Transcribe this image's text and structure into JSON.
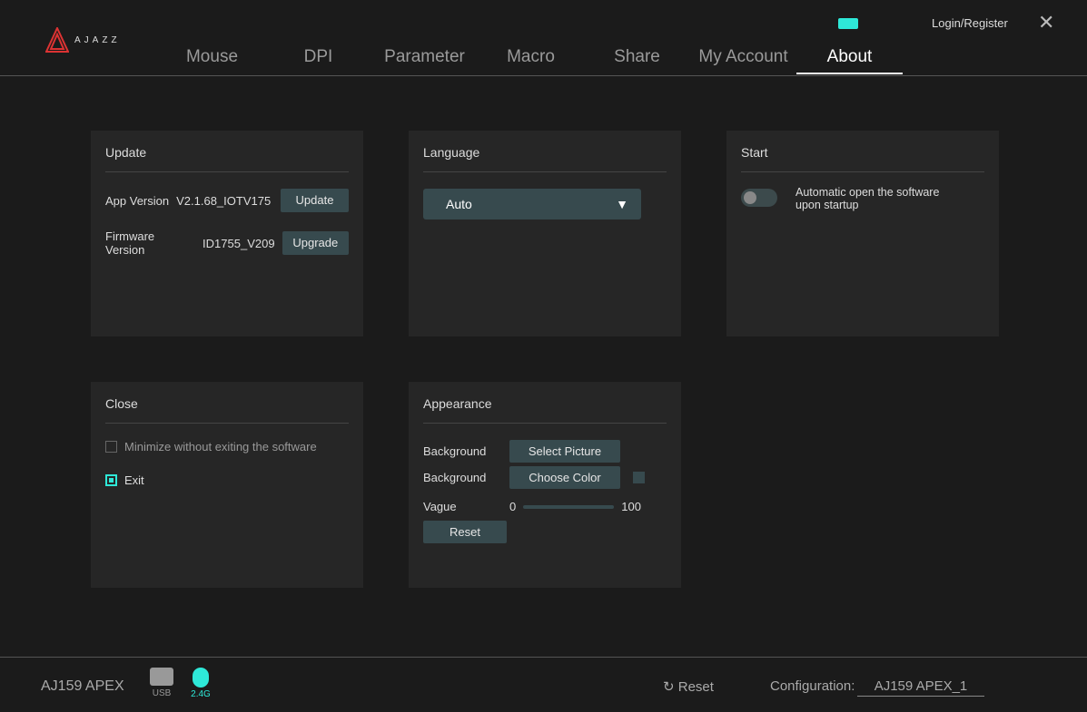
{
  "header": {
    "logo": "AJAZZ",
    "login": "Login/Register",
    "tabs": [
      "Mouse",
      "DPI",
      "Parameter",
      "Macro",
      "Share",
      "My Account",
      "About"
    ],
    "active_tab": "About"
  },
  "update": {
    "title": "Update",
    "app_version_label": "App Version",
    "app_version": "V2.1.68_IOTV175",
    "update_btn": "Update",
    "firmware_label": "Firmware Version",
    "firmware": "ID1755_V209",
    "upgrade_btn": "Upgrade"
  },
  "language": {
    "title": "Language",
    "selected": "Auto"
  },
  "start": {
    "title": "Start",
    "toggle_label": "Automatic open the software upon startup",
    "enabled": false
  },
  "close": {
    "title": "Close",
    "opt1": "Minimize without exiting the software",
    "opt2": "Exit",
    "selected": "Exit"
  },
  "appearance": {
    "title": "Appearance",
    "bg1": "Background",
    "select_picture": "Select Picture",
    "bg2": "Background",
    "choose_color": "Choose Color",
    "vague": "Vague",
    "min": "0",
    "max": "100",
    "reset": "Reset"
  },
  "footer": {
    "device": "AJ159 APEX",
    "usb": "USB",
    "wireless": "2.4G",
    "reset": "Reset",
    "config_label": "Configuration:",
    "config": "AJ159 APEX_1"
  },
  "colors": {
    "accent": "#2ee8d8",
    "button": "#374a4e"
  }
}
